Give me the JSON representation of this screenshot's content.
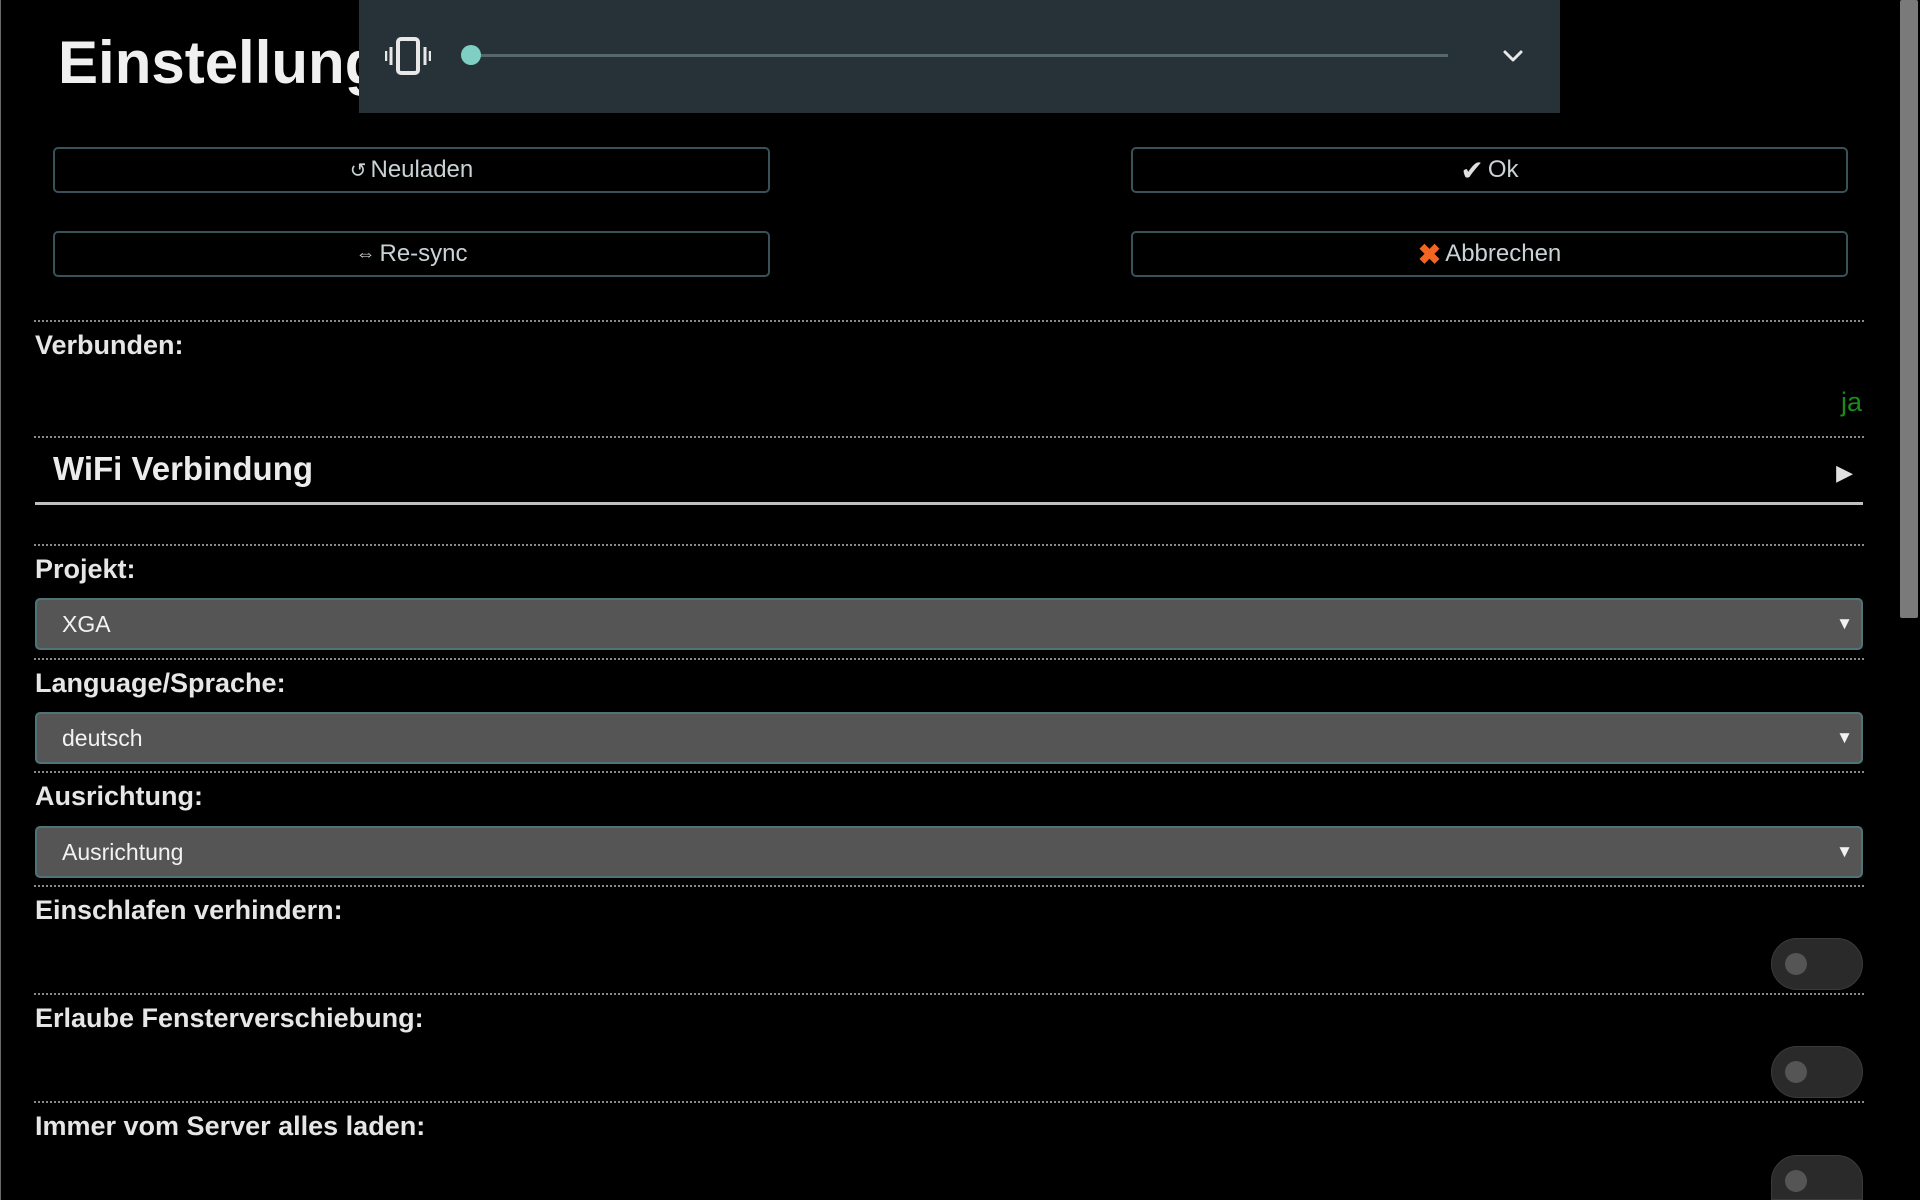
{
  "page": {
    "title": "Einstellungen"
  },
  "media_bar": {
    "vibrate_icon": "vibrate-icon",
    "slider_value": 0.0,
    "expand_icon": "chevron-down-icon",
    "accent_color": "#7fcfc5"
  },
  "buttons": {
    "reload": {
      "glyph": "↺",
      "label": "Neuladen"
    },
    "ok": {
      "glyph": "✔",
      "label": "Ok"
    },
    "resync": {
      "glyph": "⇔",
      "label": "Re-sync"
    },
    "cancel": {
      "glyph": "✖",
      "label": "Abbrechen"
    }
  },
  "connection": {
    "label": "Verbunden:",
    "value": "ja",
    "value_color": "#1a8a1a"
  },
  "wifi_section": {
    "title": "WiFi Verbindung",
    "expand_icon": "▶"
  },
  "project": {
    "label": "Projekt:",
    "selected": "XGA"
  },
  "language": {
    "label": "Language/Sprache:",
    "selected": "deutsch"
  },
  "orientation": {
    "label": "Ausrichtung:",
    "selected": "Ausrichtung"
  },
  "prevent_sleep": {
    "label": "Einschlafen verhindern:",
    "enabled": false
  },
  "allow_window_move": {
    "label": "Erlaube Fensterverschiebung:",
    "enabled": false
  },
  "always_load_server": {
    "label": "Immer vom Server alles laden:",
    "enabled": false
  },
  "select_arrow": "▼"
}
